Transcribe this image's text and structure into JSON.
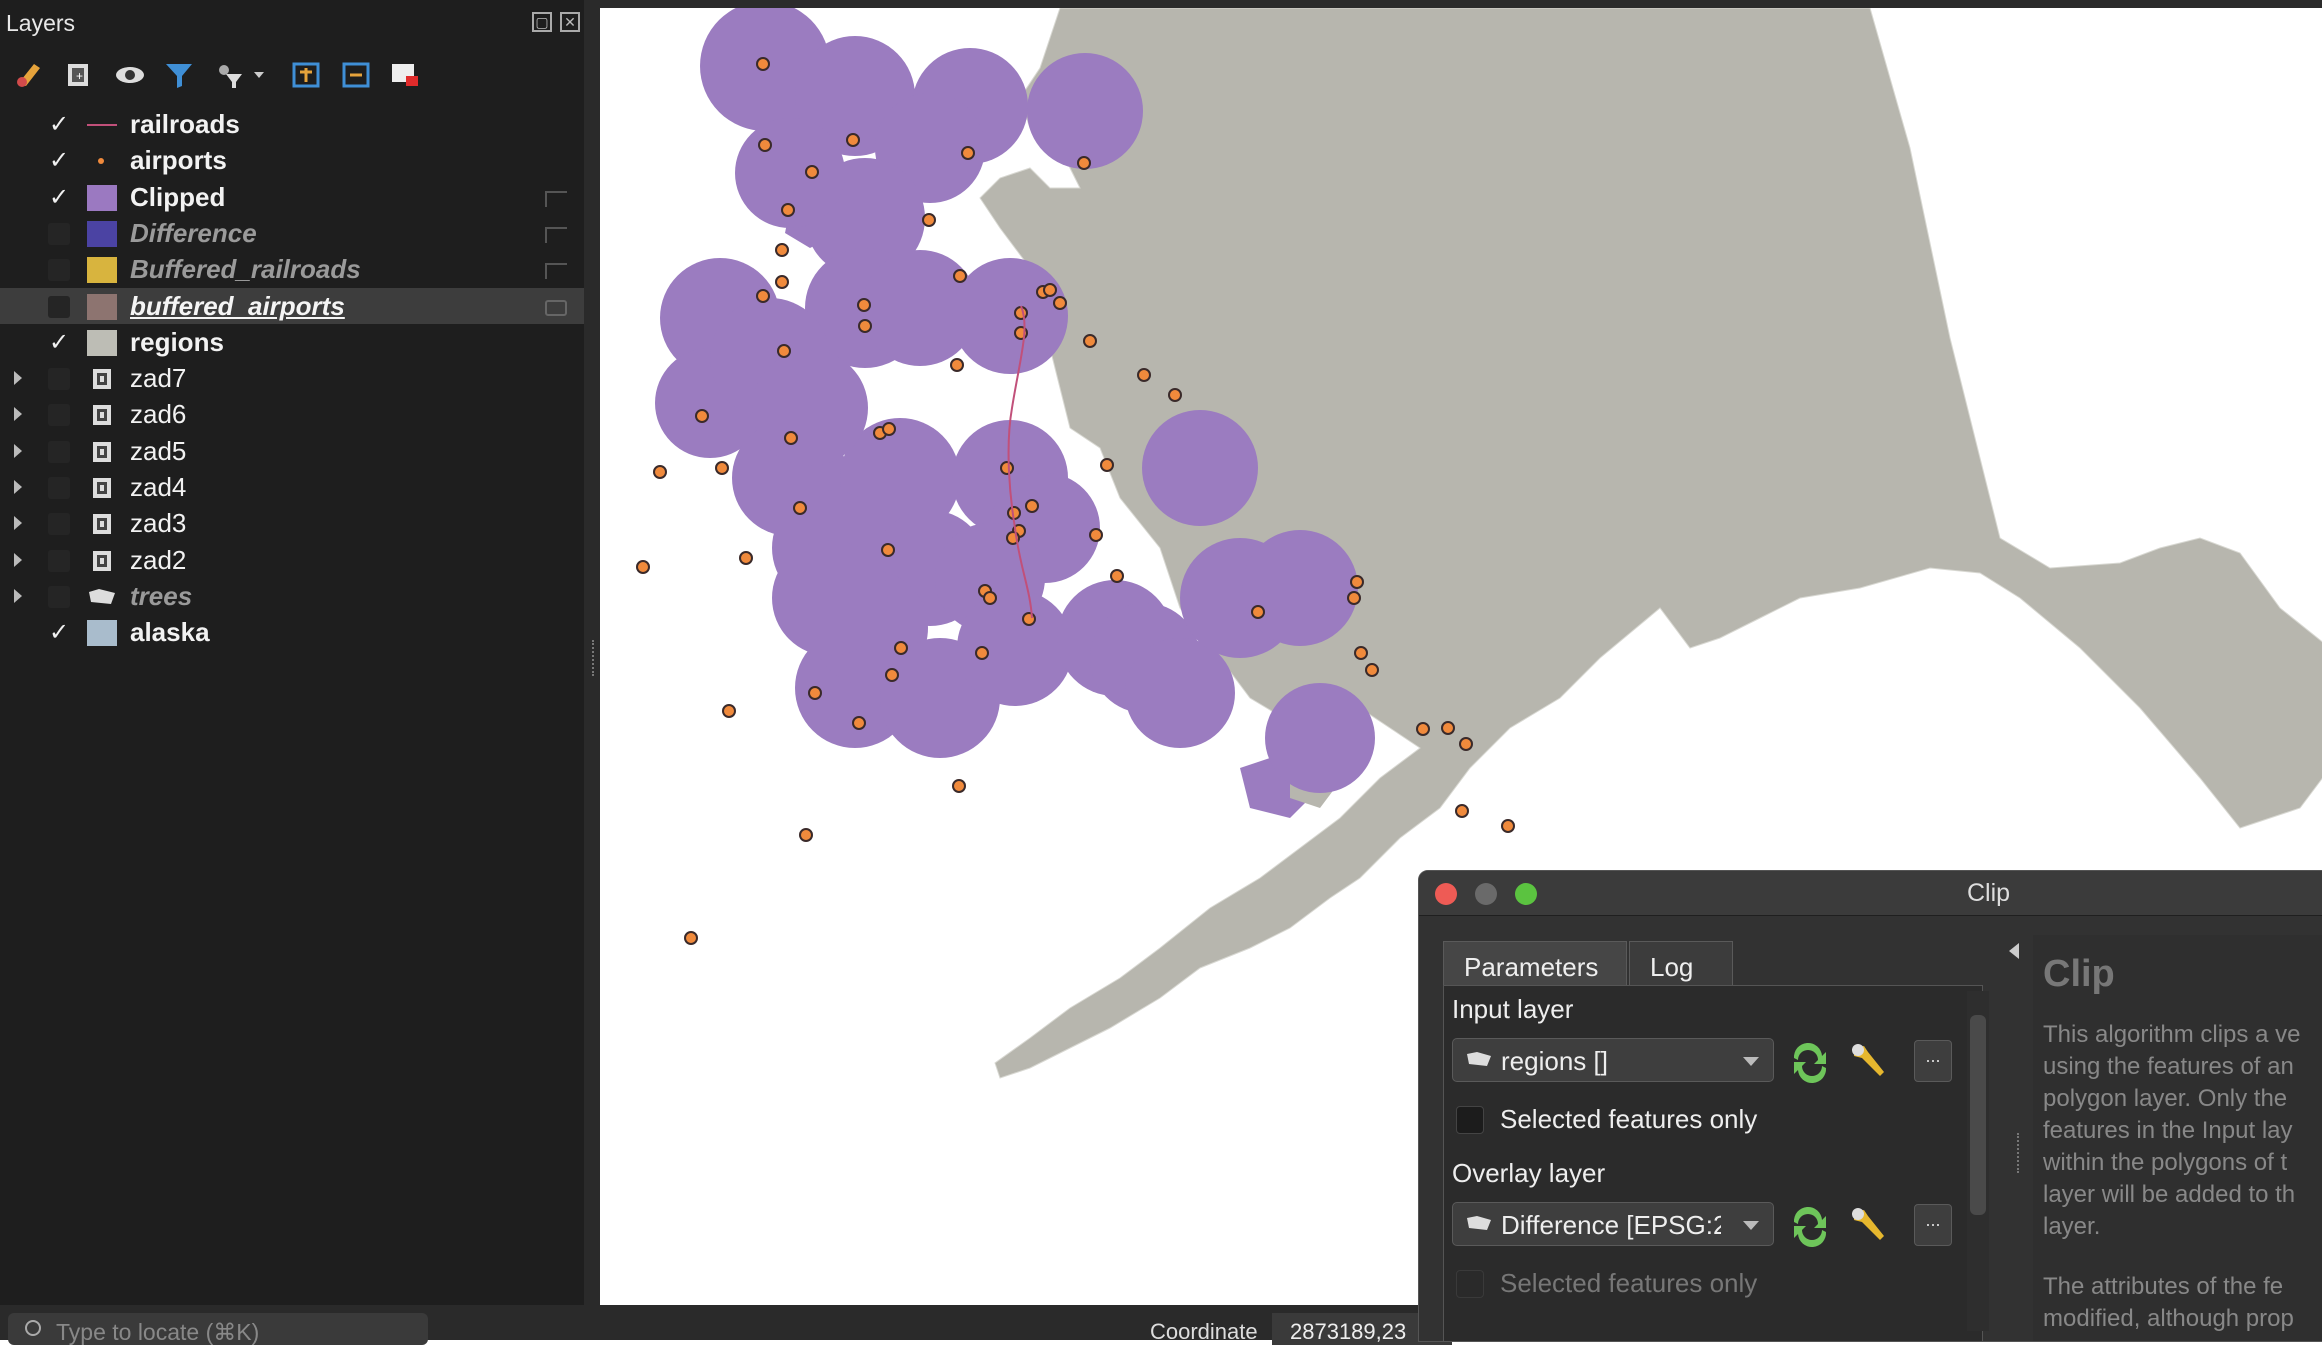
{
  "layers_panel": {
    "title": "Layers",
    "layers": [
      {
        "name": "railroads",
        "checked": true,
        "style": "line",
        "color": "#c1507a",
        "state": "visible"
      },
      {
        "name": "airports",
        "checked": true,
        "style": "point",
        "color": "#f08a3c",
        "state": "visible"
      },
      {
        "name": "Clipped",
        "checked": true,
        "style": "fill",
        "color": "#9b79c1",
        "state": "visible"
      },
      {
        "name": "Difference",
        "checked": false,
        "style": "fill",
        "color": "#4b43a3",
        "state": "hidden"
      },
      {
        "name": "Buffered_railroads",
        "checked": false,
        "style": "fill",
        "color": "#d8b43e",
        "state": "hidden"
      },
      {
        "name": "buffered_airports",
        "checked": false,
        "style": "fill",
        "color": "#8d7470",
        "state": "current"
      },
      {
        "name": "regions",
        "checked": true,
        "style": "fill",
        "color": "#bdbdb5",
        "state": "visible"
      },
      {
        "name": "zad7",
        "checked": false,
        "style": "group",
        "state": "group"
      },
      {
        "name": "zad6",
        "checked": false,
        "style": "group",
        "state": "group"
      },
      {
        "name": "zad5",
        "checked": false,
        "style": "group",
        "state": "group"
      },
      {
        "name": "zad4",
        "checked": false,
        "style": "group",
        "state": "group"
      },
      {
        "name": "zad3",
        "checked": false,
        "style": "group",
        "state": "group"
      },
      {
        "name": "zad2",
        "checked": false,
        "style": "group",
        "state": "group"
      },
      {
        "name": "trees",
        "checked": false,
        "style": "raster",
        "state": "hidden-group"
      },
      {
        "name": "alaska",
        "checked": true,
        "style": "fill",
        "color": "#a9bccc",
        "state": "visible"
      }
    ]
  },
  "map": {
    "land_color": "#b7b6ae",
    "buffer_color": "#9b7cc0",
    "airport_color": "#f08a3c",
    "railroad_color": "#c1507a"
  },
  "status_bar": {
    "locator_placeholder": "Type to locate (⌘K)",
    "coordinate_label": "Coordinate",
    "coordinate_value": "2873189,23"
  },
  "clip_dialog": {
    "title": "Clip",
    "tabs": [
      "Parameters",
      "Log"
    ],
    "input_layer_label": "Input layer",
    "input_layer_value": "regions []",
    "selected_only_label": "Selected features only",
    "overlay_layer_label": "Overlay layer",
    "overlay_layer_value": "Difference [EPSG:2",
    "overlay_selected_only_label": "Selected features only",
    "ellipsis": "...",
    "help_title": "Clip",
    "help_text": "This algorithm clips a ve\nusing the features of an\npolygon layer. Only the\nfeatures in the Input lay\nwithin the polygons of t\nlayer will be added to th\nlayer.",
    "help_text2": "The attributes of the fe\nmodified, although prop"
  }
}
